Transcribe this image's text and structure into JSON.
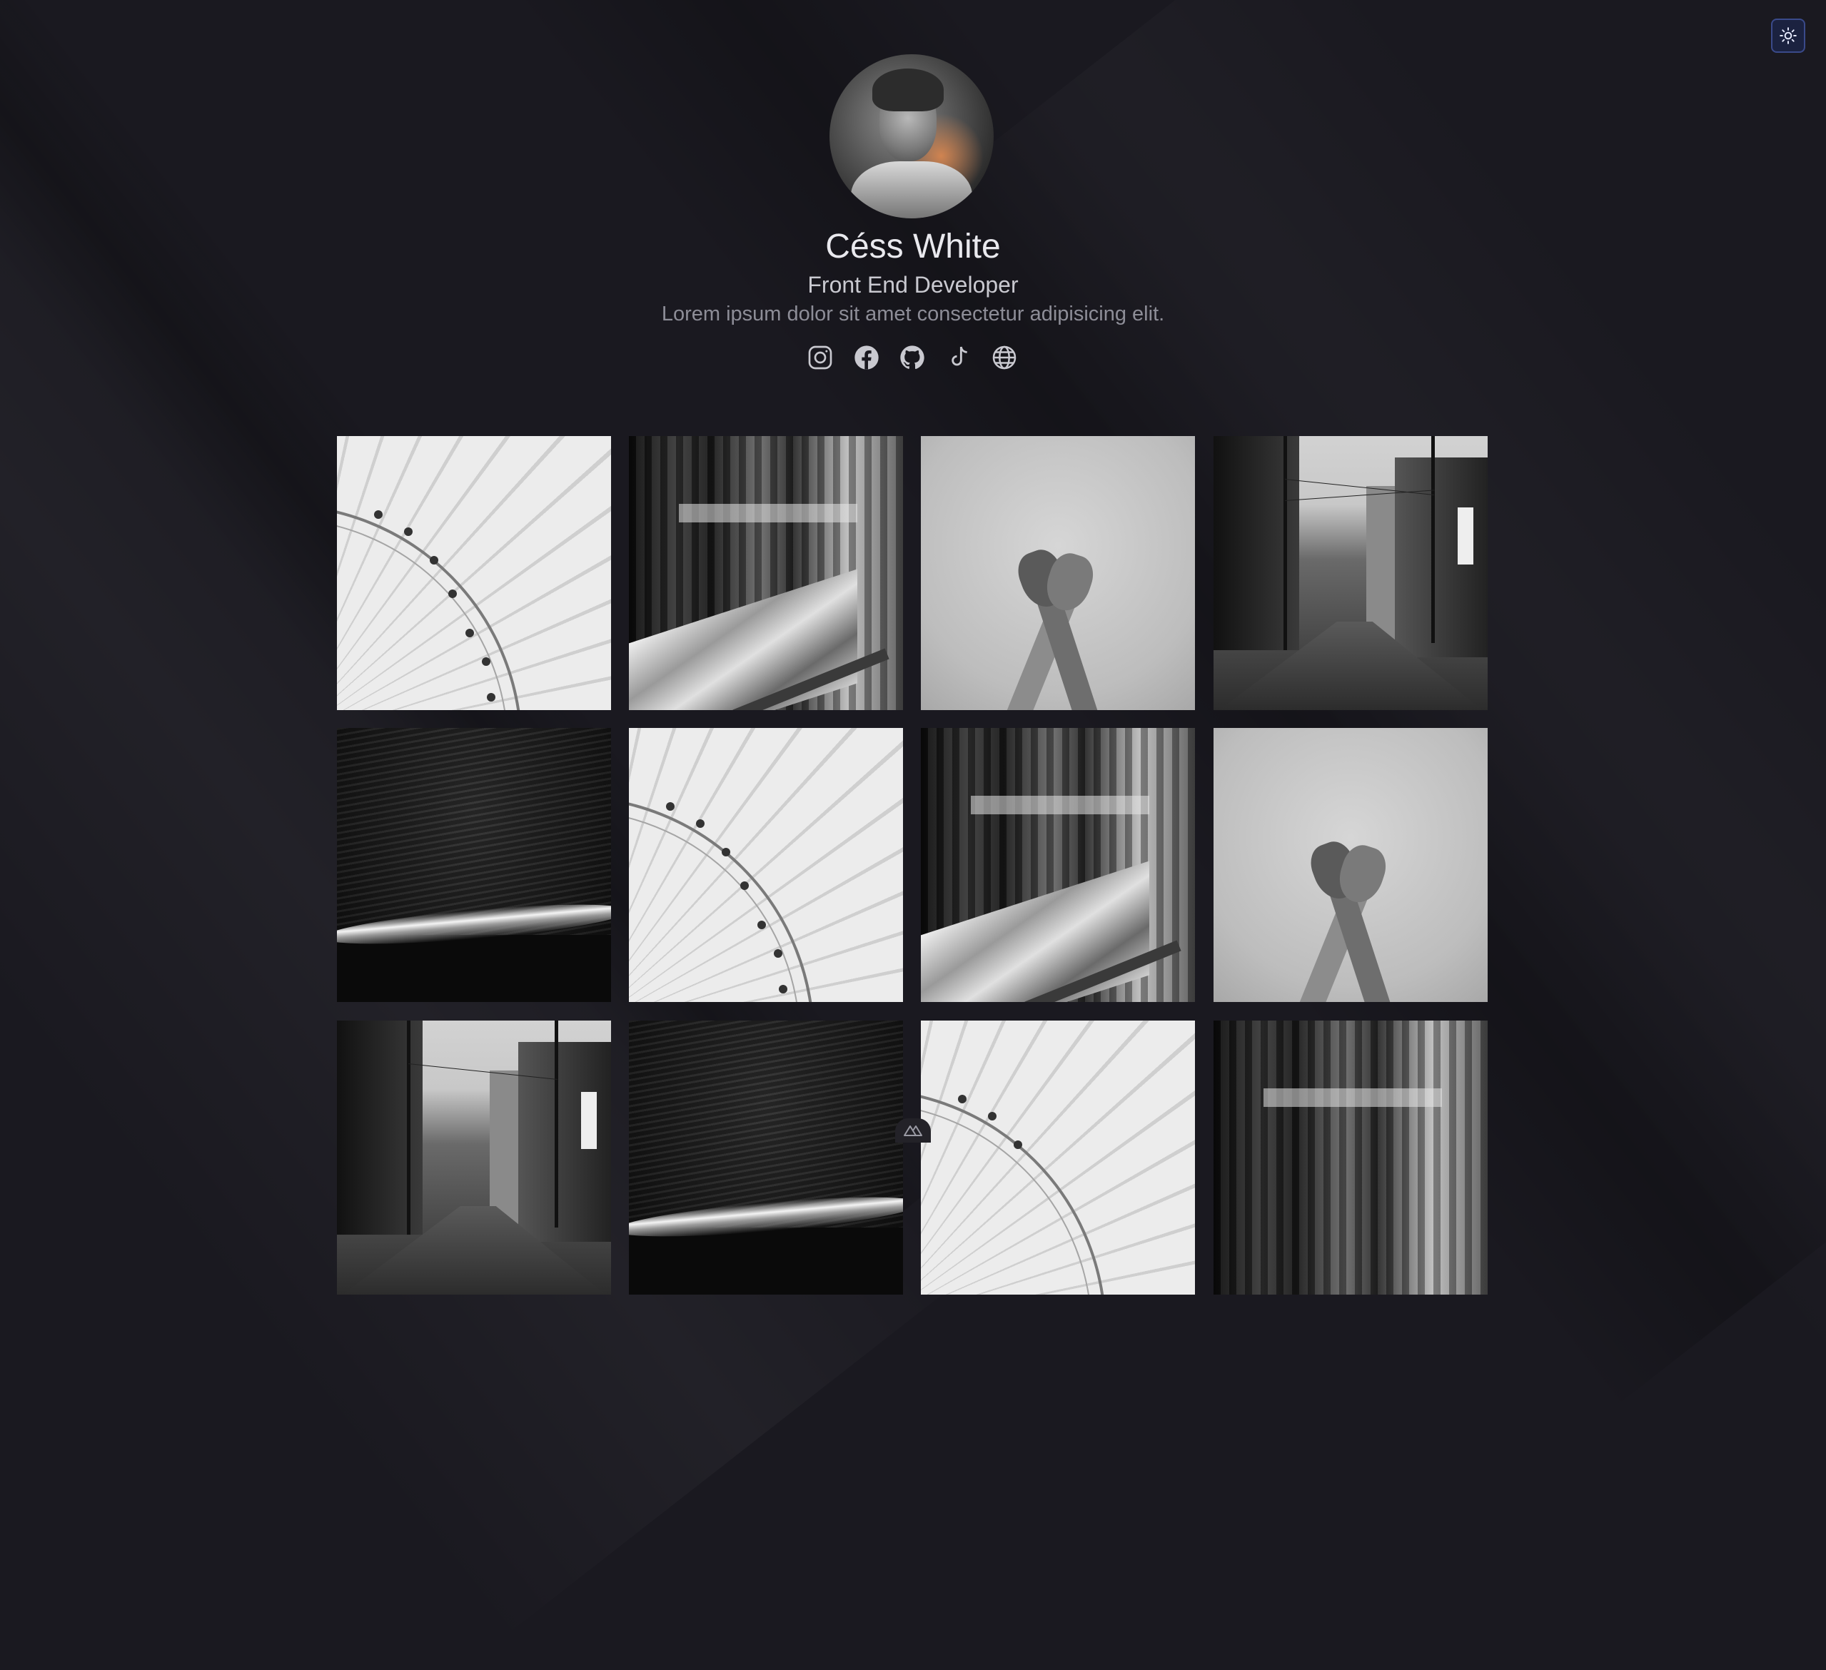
{
  "profile": {
    "name": "Céss White",
    "role": "Front End Developer",
    "bio": "Lorem ipsum dolor sit amet consectetur adipisicing elit."
  },
  "socials": [
    {
      "icon": "instagram-icon"
    },
    {
      "icon": "facebook-icon"
    },
    {
      "icon": "github-icon"
    },
    {
      "icon": "tiktok-icon"
    },
    {
      "icon": "globe-icon"
    }
  ],
  "theme_toggle": {
    "icon": "sun-icon",
    "accent": "#3a4a8a"
  },
  "gallery": [
    {
      "subject": "ferris-wheel"
    },
    {
      "subject": "curtain-bed"
    },
    {
      "subject": "hands"
    },
    {
      "subject": "street"
    },
    {
      "subject": "waves"
    },
    {
      "subject": "ferris-wheel"
    },
    {
      "subject": "curtain-bed"
    },
    {
      "subject": "hands"
    },
    {
      "subject": "street"
    },
    {
      "subject": "waves"
    },
    {
      "subject": "ferris-wheel"
    },
    {
      "subject": "curtain-bed"
    }
  ],
  "colors": {
    "background": "#1a1920",
    "name_text": "#e9e9ee",
    "muted_text": "#8d8d97"
  }
}
